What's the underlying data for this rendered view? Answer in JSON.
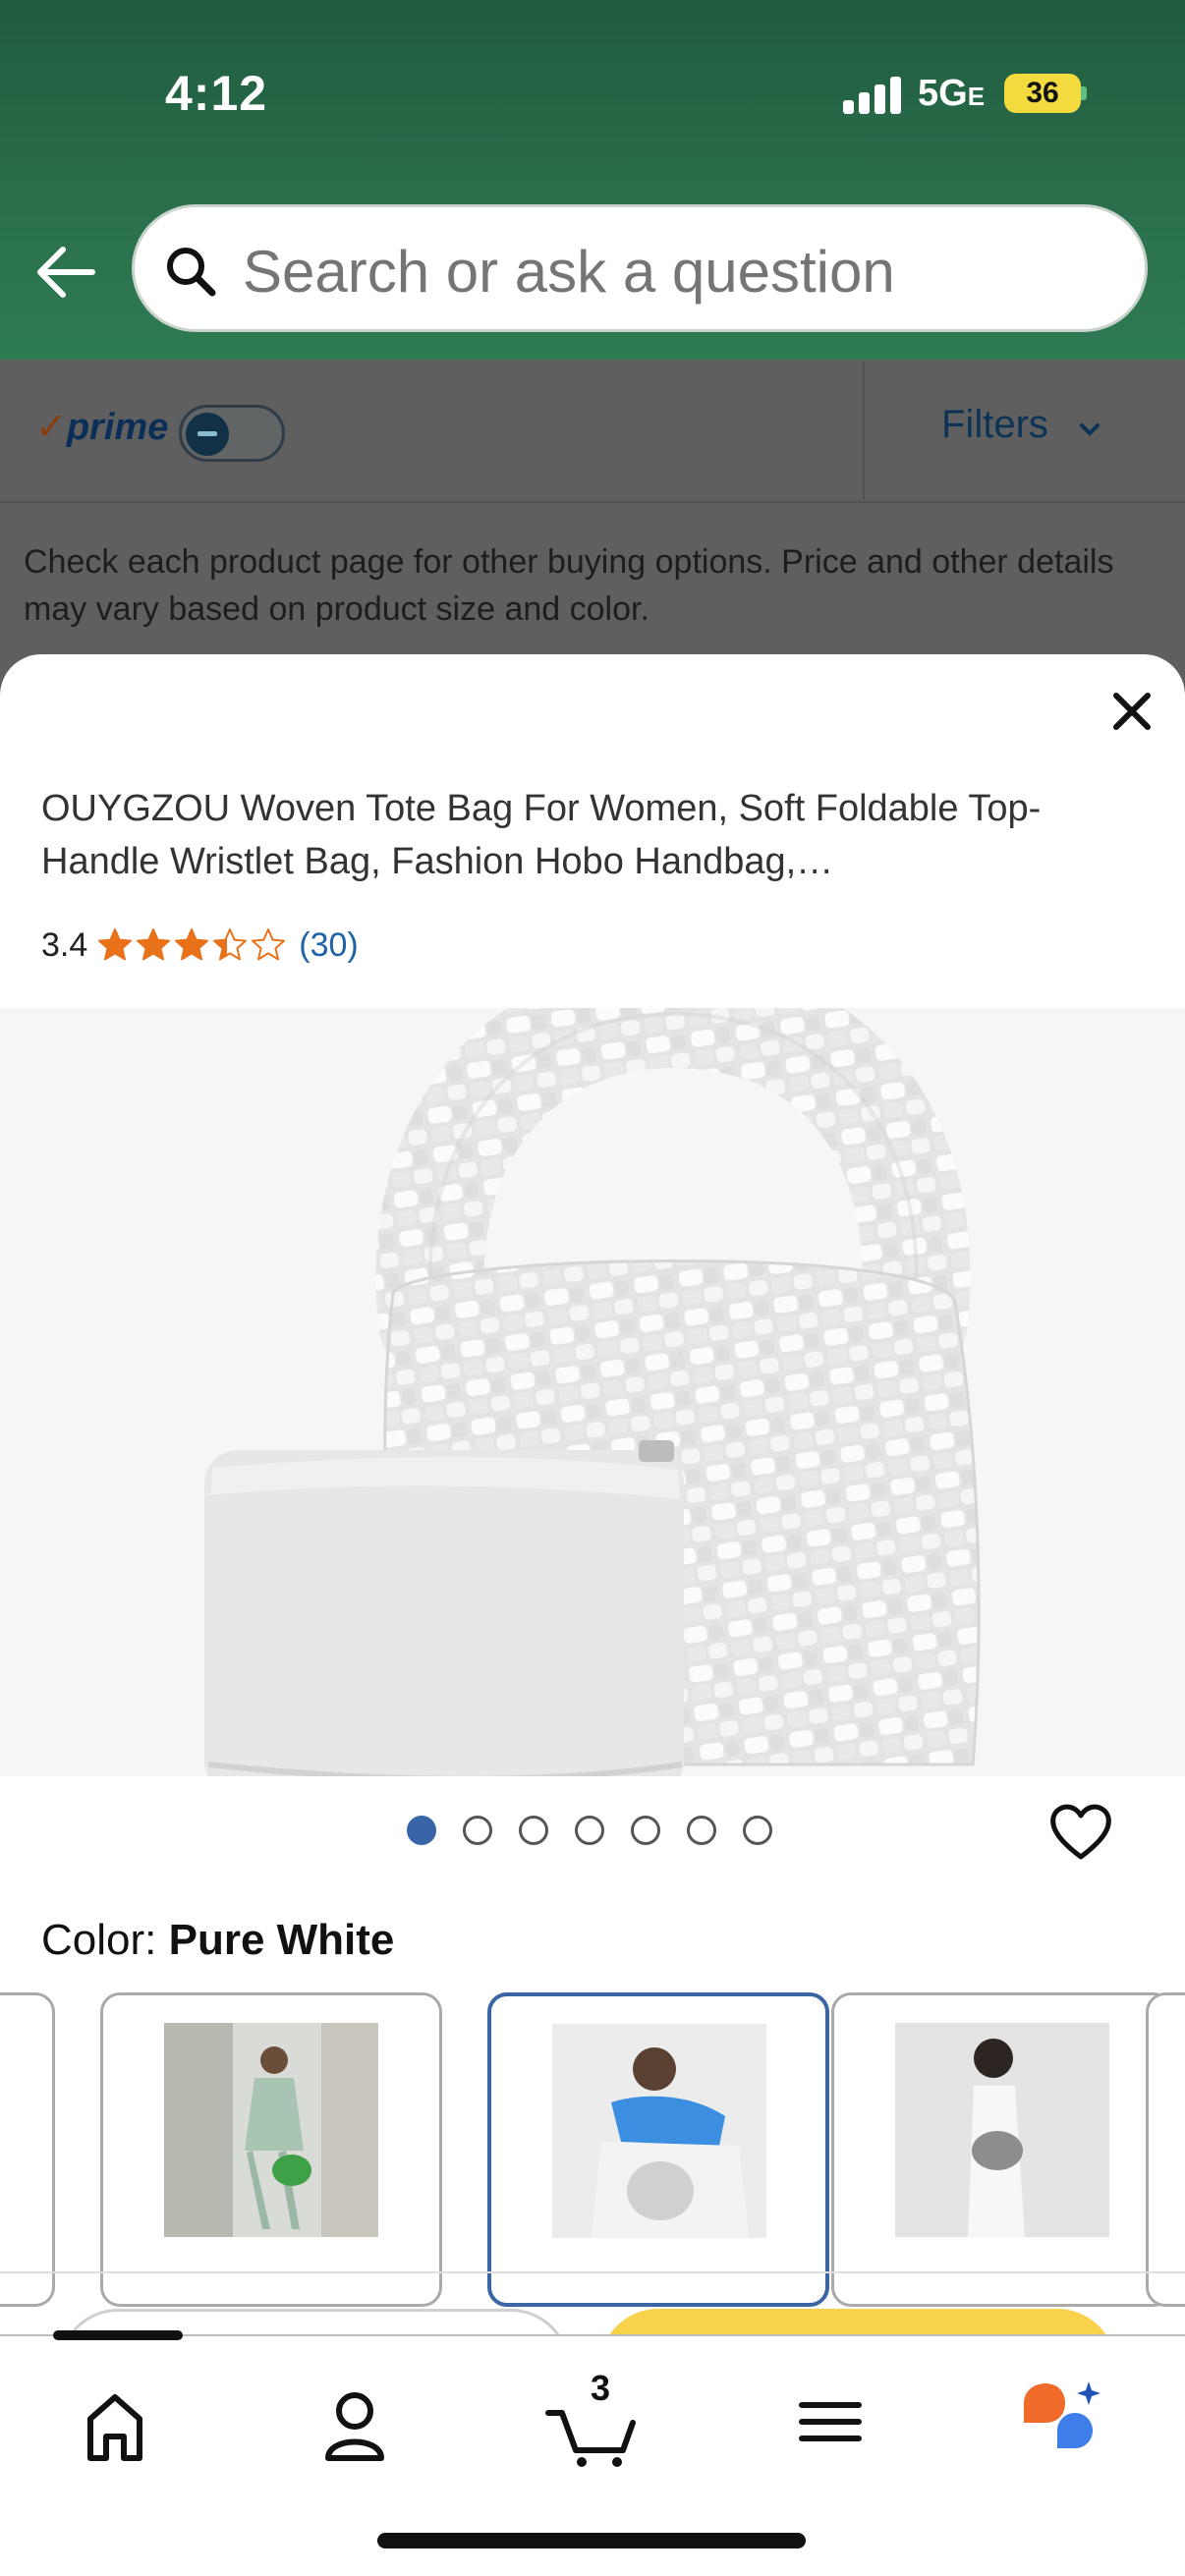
{
  "status_bar": {
    "time": "4:12",
    "network": "5G",
    "network_suffix": "E",
    "battery": "36"
  },
  "search": {
    "placeholder": "Search or ask a question"
  },
  "filter_bar": {
    "prime_label": "prime",
    "prime_toggle_on": false,
    "filters_label": "Filters"
  },
  "notice": "Check each product page for other buying options. Price and other details may vary based on product size and color.",
  "product": {
    "title": "OUYGZOU Woven Tote Bag For Women, Soft Foldable Top-Handle Wristlet Bag, Fashion Hobo Handbag,…",
    "rating": "3.4",
    "rating_value": 3.4,
    "rating_count": "(30)",
    "image_icon": "woven-tote-bag-image",
    "image_count": 7,
    "active_image_index": 0
  },
  "color": {
    "label": "Color:",
    "selected": "Pure White"
  },
  "swatches": [
    {
      "icon": "swatch-green-bag-photo"
    },
    {
      "icon": "swatch-white-bag-photo",
      "selected": true
    },
    {
      "icon": "swatch-silver-bag-photo"
    }
  ],
  "tab_bar": {
    "items": [
      "home-icon",
      "account-icon",
      "cart-icon",
      "menu-icon",
      "rufus-ai-icon"
    ],
    "cart_count": "3"
  },
  "colors": {
    "accent": "#3a64a8",
    "star": "#e8711a",
    "link": "#1f63a6",
    "header_green": "#286b49"
  }
}
